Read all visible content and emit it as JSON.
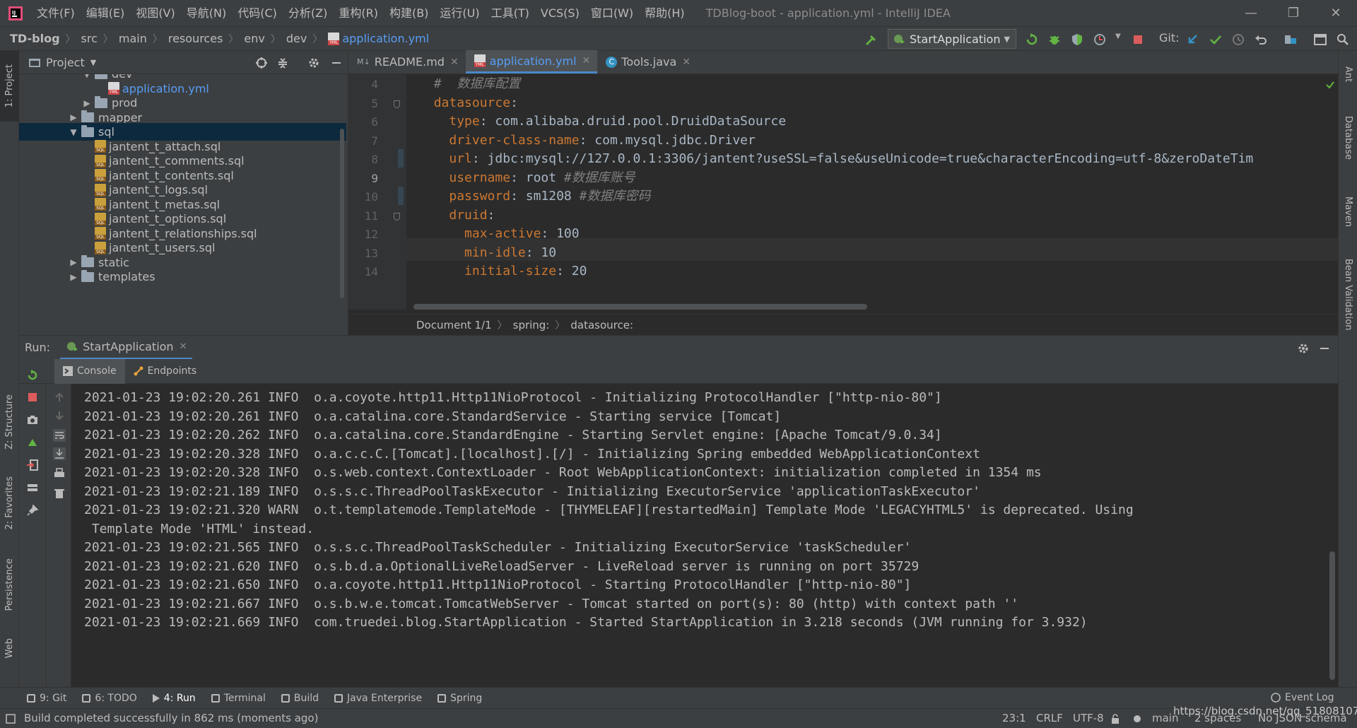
{
  "menu": [
    "文件(F)",
    "编辑(E)",
    "视图(V)",
    "导航(N)",
    "代码(C)",
    "分析(Z)",
    "重构(R)",
    "构建(B)",
    "运行(U)",
    "工具(T)",
    "VCS(S)",
    "窗口(W)",
    "帮助(H)"
  ],
  "window_title": "TDBlog-boot - application.yml - IntelliJ IDEA",
  "breadcrumb": [
    "TD-blog",
    "src",
    "main",
    "resources",
    "env",
    "dev",
    "application.yml"
  ],
  "run_config": "StartApplication",
  "git_label": "Git:",
  "left_tabs": [
    "1: Project",
    "Z: Structure",
    "2: Favorites",
    "Persistence",
    "Web"
  ],
  "right_tabs": [
    "Ant",
    "Database",
    "Maven",
    "Bean Validation"
  ],
  "project": {
    "title": "Project",
    "tree": [
      {
        "label": "dev",
        "type": "folder",
        "open": true,
        "indent": 1
      },
      {
        "label": "application.yml",
        "type": "yml",
        "indent": 2
      },
      {
        "label": "prod",
        "type": "folder",
        "open": false,
        "indent": 1
      },
      {
        "label": "mapper",
        "type": "folder",
        "open": false,
        "indent": 0
      },
      {
        "label": "sql",
        "type": "folder",
        "open": true,
        "indent": 0,
        "selected": true
      },
      {
        "label": "jantent_t_attach.sql",
        "type": "sql",
        "indent": 1
      },
      {
        "label": "jantent_t_comments.sql",
        "type": "sql",
        "indent": 1
      },
      {
        "label": "jantent_t_contents.sql",
        "type": "sql",
        "indent": 1
      },
      {
        "label": "jantent_t_logs.sql",
        "type": "sql",
        "indent": 1
      },
      {
        "label": "jantent_t_metas.sql",
        "type": "sql",
        "indent": 1
      },
      {
        "label": "jantent_t_options.sql",
        "type": "sql",
        "indent": 1
      },
      {
        "label": "jantent_t_relationships.sql",
        "type": "sql",
        "indent": 1
      },
      {
        "label": "jantent_t_users.sql",
        "type": "sql",
        "indent": 1
      },
      {
        "label": "static",
        "type": "folder",
        "open": false,
        "indent": 0
      },
      {
        "label": "templates",
        "type": "folder",
        "open": false,
        "indent": 0
      }
    ]
  },
  "editor": {
    "tabs": [
      {
        "label": "README.md",
        "active": false
      },
      {
        "label": "application.yml",
        "active": true
      },
      {
        "label": "Tools.java",
        "active": false
      }
    ],
    "line_numbers": [
      "4",
      "5",
      "6",
      "7",
      "8",
      "9",
      "10",
      "11",
      "12",
      "13",
      "14"
    ],
    "current_line": "9",
    "lines": [
      [
        {
          "t": "  ",
          "c": ""
        },
        {
          "t": "#  数据库配置",
          "c": "cm"
        }
      ],
      [
        {
          "t": "  ",
          "c": ""
        },
        {
          "t": "datasource",
          "c": "k"
        },
        {
          "t": ":",
          "c": ""
        }
      ],
      [
        {
          "t": "    ",
          "c": ""
        },
        {
          "t": "type",
          "c": "k"
        },
        {
          "t": ": com.alibaba.druid.pool.DruidDataSource",
          "c": ""
        }
      ],
      [
        {
          "t": "    ",
          "c": ""
        },
        {
          "t": "driver-class-name",
          "c": "k"
        },
        {
          "t": ": com.mysql.jdbc.Driver",
          "c": ""
        }
      ],
      [
        {
          "t": "    ",
          "c": ""
        },
        {
          "t": "url",
          "c": "k"
        },
        {
          "t": ": jdbc:mysql://127.0.0.1:3306/jantent?useSSL=false&useUnicode=true&characterEncoding=utf-8&zeroDateTim",
          "c": ""
        }
      ],
      [
        {
          "t": "    ",
          "c": ""
        },
        {
          "t": "username",
          "c": "k"
        },
        {
          "t": ": root ",
          "c": ""
        },
        {
          "t": "#数据库账号",
          "c": "cm"
        }
      ],
      [
        {
          "t": "    ",
          "c": ""
        },
        {
          "t": "password",
          "c": "k"
        },
        {
          "t": ": sm1208 ",
          "c": ""
        },
        {
          "t": "#数据库密码",
          "c": "cm"
        }
      ],
      [
        {
          "t": "    ",
          "c": ""
        },
        {
          "t": "druid",
          "c": "k"
        },
        {
          "t": ":",
          "c": ""
        }
      ],
      [
        {
          "t": "      ",
          "c": ""
        },
        {
          "t": "max-active",
          "c": "k"
        },
        {
          "t": ": 100",
          "c": ""
        }
      ],
      [
        {
          "t": "      ",
          "c": ""
        },
        {
          "t": "min-idle",
          "c": "k"
        },
        {
          "t": ": 10",
          "c": ""
        }
      ],
      [
        {
          "t": "      ",
          "c": ""
        },
        {
          "t": "initial-size",
          "c": "k"
        },
        {
          "t": ": 20",
          "c": ""
        }
      ]
    ],
    "breadcrumb": [
      "Document 1/1",
      "spring:",
      "datasource:"
    ]
  },
  "run": {
    "label": "Run:",
    "config": "StartApplication",
    "subtabs": [
      "Console",
      "Endpoints"
    ],
    "log": [
      "2021-01-23 19:02:20.261 INFO  o.a.coyote.http11.Http11NioProtocol - Initializing ProtocolHandler [\"http-nio-80\"]",
      "2021-01-23 19:02:20.261 INFO  o.a.catalina.core.StandardService - Starting service [Tomcat]",
      "2021-01-23 19:02:20.262 INFO  o.a.catalina.core.StandardEngine - Starting Servlet engine: [Apache Tomcat/9.0.34]",
      "2021-01-23 19:02:20.328 INFO  o.a.c.c.C.[Tomcat].[localhost].[/] - Initializing Spring embedded WebApplicationContext",
      "2021-01-23 19:02:20.328 INFO  o.s.web.context.ContextLoader - Root WebApplicationContext: initialization completed in 1354 ms",
      "2021-01-23 19:02:21.189 INFO  o.s.s.c.ThreadPoolTaskExecutor - Initializing ExecutorService 'applicationTaskExecutor'",
      "2021-01-23 19:02:21.320 WARN  o.t.templatemode.TemplateMode - [THYMELEAF][restartedMain] Template Mode 'LEGACYHTML5' is deprecated. Using",
      " Template Mode 'HTML' instead.",
      "2021-01-23 19:02:21.565 INFO  o.s.s.c.ThreadPoolTaskScheduler - Initializing ExecutorService 'taskScheduler'",
      "2021-01-23 19:02:21.620 INFO  o.s.b.d.a.OptionalLiveReloadServer - LiveReload server is running on port 35729",
      "2021-01-23 19:02:21.650 INFO  o.a.coyote.http11.Http11NioProtocol - Starting ProtocolHandler [\"http-nio-80\"]",
      "2021-01-23 19:02:21.667 INFO  o.s.b.w.e.tomcat.TomcatWebServer - Tomcat started on port(s): 80 (http) with context path ''",
      "2021-01-23 19:02:21.669 INFO  com.truedei.blog.StartApplication - Started StartApplication in 3.218 seconds (JVM running for 3.932)"
    ]
  },
  "bottom_tools": [
    {
      "label": "9: Git",
      "icon": "git-icon"
    },
    {
      "label": "6: TODO",
      "icon": "todo-icon"
    },
    {
      "label": "4: Run",
      "icon": "run-icon"
    },
    {
      "label": "Terminal",
      "icon": "terminal-icon"
    },
    {
      "label": "Build",
      "icon": "build-icon"
    },
    {
      "label": "Java Enterprise",
      "icon": "java-enterprise-icon"
    },
    {
      "label": "Spring",
      "icon": "spring-icon"
    }
  ],
  "event_log": "Event Log",
  "status": {
    "message": "Build completed successfully in 862 ms (moments ago)",
    "position": "23:1",
    "line_sep": "CRLF",
    "encoding": "UTF-8",
    "branch": "main",
    "indent": "2 spaces",
    "schema": "No JSON schema",
    "watermark": "https://blog.csdn.net/qq_51808107"
  },
  "colors": {
    "accent": "#4a88c7",
    "keyword": "#cc7832",
    "comment": "#808080",
    "selection": "#0d293e"
  }
}
